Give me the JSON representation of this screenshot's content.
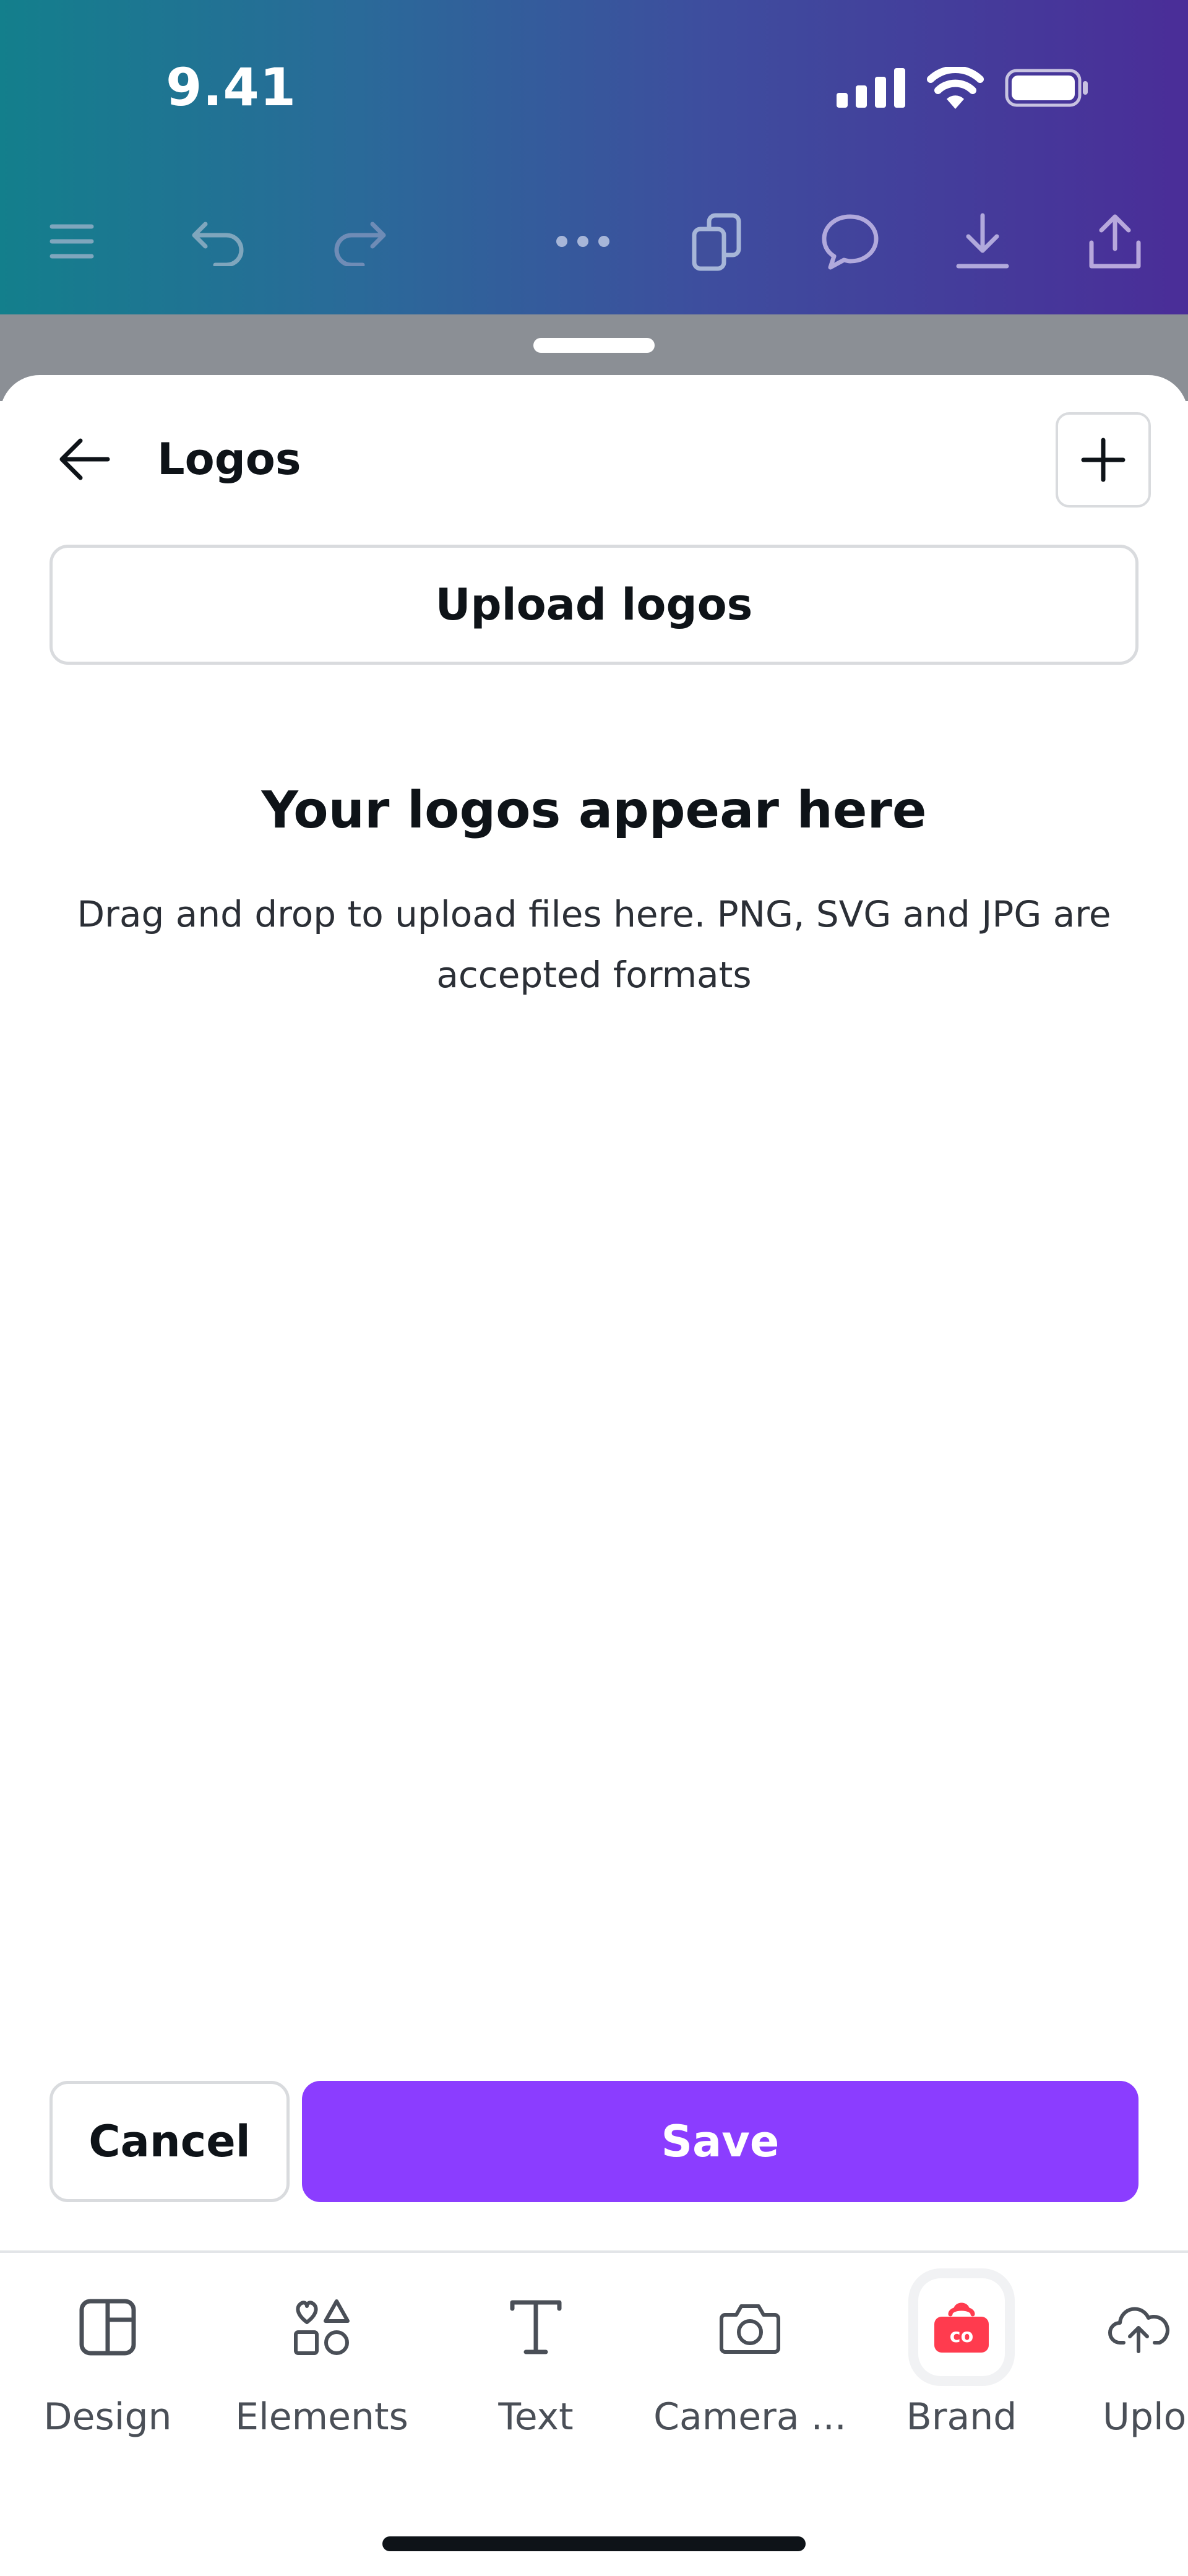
{
  "status_bar": {
    "time": "9.41"
  },
  "sheet": {
    "title": "Logos",
    "upload_label": "Upload logos",
    "empty_title": "Your logos appear here",
    "empty_description": "Drag and drop to upload files here. PNG, SVG and JPG are accepted formats"
  },
  "actions": {
    "cancel_label": "Cancel",
    "save_label": "Save"
  },
  "bottom_nav": {
    "items": [
      {
        "label": "Design",
        "icon": "design-icon"
      },
      {
        "label": "Elements",
        "icon": "elements-icon"
      },
      {
        "label": "Text",
        "icon": "text-icon"
      },
      {
        "label": "Camera ...",
        "icon": "camera-icon"
      },
      {
        "label": "Brand",
        "icon": "brand-icon"
      },
      {
        "label": "Uplo",
        "icon": "upload-cloud-icon"
      }
    ]
  },
  "colors": {
    "accent": "#8b3dff",
    "brand_red": "#ff3b4e",
    "header_gradient_start": "#137f8c",
    "header_gradient_end": "#4a2d98"
  }
}
